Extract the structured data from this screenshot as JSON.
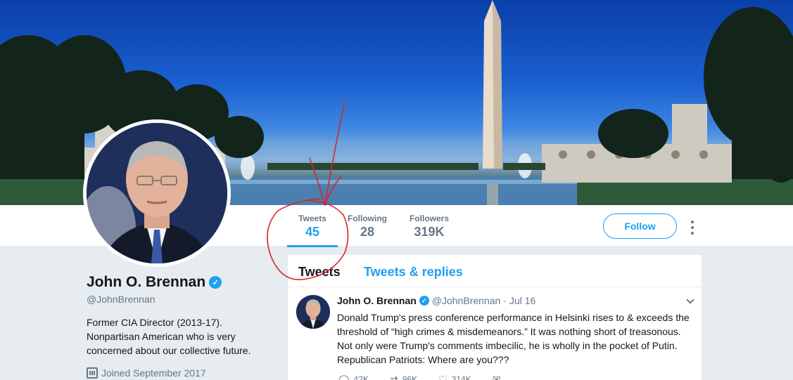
{
  "profile": {
    "name": "John O. Brennan",
    "verified_glyph": "✓",
    "handle": "@JohnBrennan",
    "bio": "Former CIA Director (2013-17). Nonpartisan American who is very concerned about our collective future.",
    "joined": "Joined September 2017"
  },
  "stats": {
    "tweets": {
      "label": "Tweets",
      "value": "45"
    },
    "following": {
      "label": "Following",
      "value": "28"
    },
    "followers": {
      "label": "Followers",
      "value": "319K"
    }
  },
  "actions": {
    "follow_label": "Follow"
  },
  "timeline": {
    "tabs": [
      {
        "label": "Tweets"
      },
      {
        "label": "Tweets & replies"
      }
    ],
    "tweet": {
      "name": "John O. Brennan",
      "handle": "@JohnBrennan",
      "separator": "·",
      "time": "Jul 16",
      "text": "Donald Trump's press conference performance in Helsinki rises to & exceeds the threshold of “high crimes & misdemeanors.” It was nothing short of treasonous. Not only were Trump's comments imbecilic, he is wholly in the pocket of Putin. Republican Patriots: Where are you???",
      "counts": {
        "replies": "42K",
        "retweets": "96K",
        "likes": "314K"
      }
    }
  },
  "colors": {
    "accent": "#1da1f2",
    "annotation": "#d9242a",
    "muted": "#657786"
  },
  "icons": [
    "verified-badge-icon",
    "calendar-icon",
    "more-options-icon",
    "chevron-down-icon",
    "reply-icon",
    "retweet-icon",
    "like-icon",
    "message-icon"
  ]
}
